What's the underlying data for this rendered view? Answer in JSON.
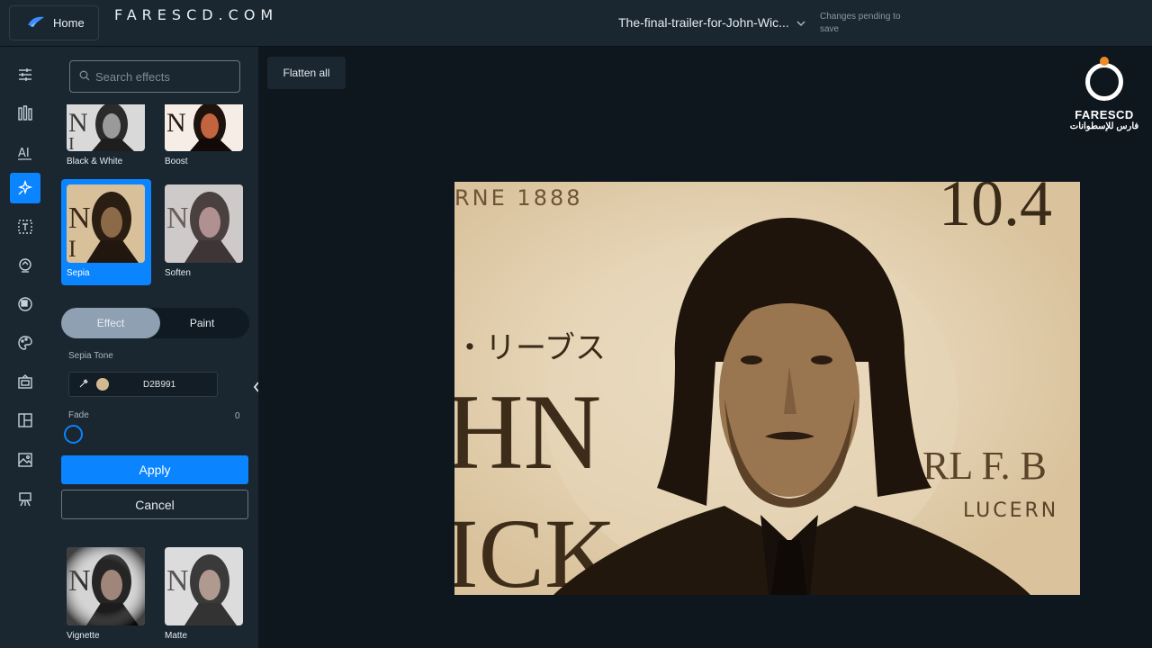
{
  "topbar": {
    "home_label": "Home",
    "brand": "FARESCD.COM",
    "document_title": "The-final-trailer-for-John-Wic...",
    "save_status": "Changes pending to save"
  },
  "rail": {
    "items": [
      "adjust-icon",
      "filters-icon",
      "text-ai-icon",
      "effects-icon",
      "text-icon",
      "sticker-icon",
      "overlay-icon",
      "paint-icon",
      "frame-icon",
      "layout-icon",
      "image-icon",
      "easel-icon"
    ],
    "active": "effects-icon"
  },
  "panel": {
    "search_placeholder": "Search effects",
    "effects": [
      {
        "label": "Black & White"
      },
      {
        "label": "Boost"
      },
      {
        "label": "Sepia"
      },
      {
        "label": "Soften"
      },
      {
        "label": "Vignette"
      },
      {
        "label": "Matte"
      }
    ],
    "selected_effect": "Sepia",
    "mode_tabs": {
      "effect": "Effect",
      "paint": "Paint",
      "active": "Effect"
    },
    "sepia_tone_label": "Sepia Tone",
    "sepia_tone_hex": "D2B991",
    "sepia_tone_color": "#D2B991",
    "fade_label": "Fade",
    "fade_value": "0",
    "apply_label": "Apply",
    "cancel_label": "Cancel"
  },
  "canvas": {
    "flatten_label": "Flatten all",
    "logo_name": "FARESCD",
    "logo_sub": "فارس للإسطوانات",
    "photo_text": {
      "top_left": "RNE 1888",
      "top_right": "10.4",
      "japanese": "・リーブス",
      "left_big": "HN",
      "left_big2": "ICK",
      "right_brand": "RL F. B",
      "right_sub": "LUCERN"
    }
  },
  "colors": {
    "accent": "#0a84ff",
    "panel_bg": "#1a2630",
    "canvas_bg": "#0f171e",
    "sepia": "#D2B991"
  }
}
